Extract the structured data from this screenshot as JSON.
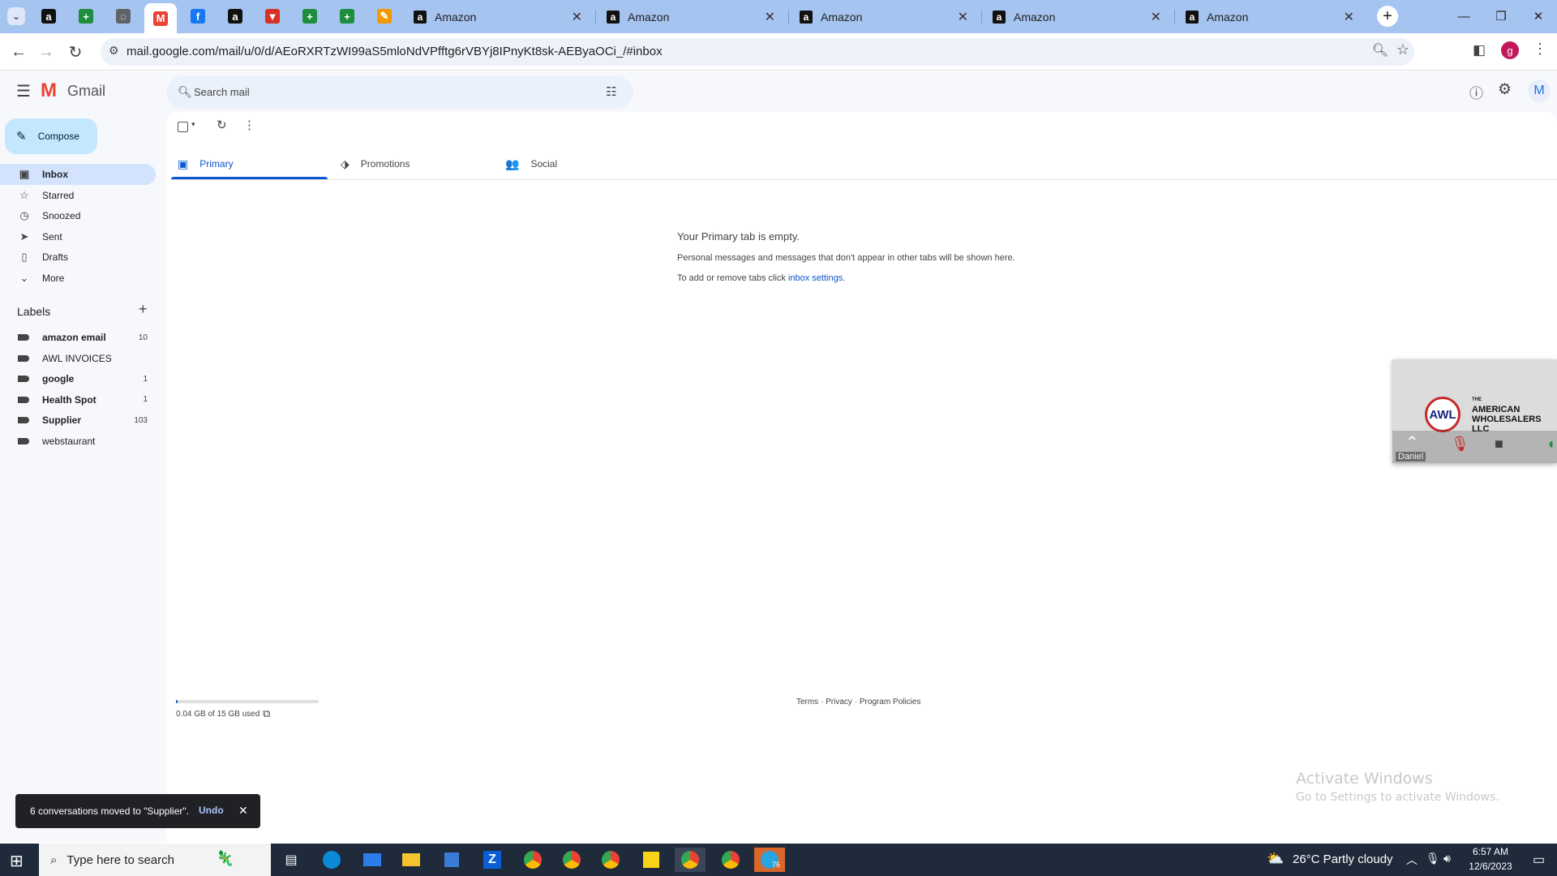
{
  "browser": {
    "pinned_tabs": [
      {
        "icon": "amazon-icon",
        "glyph": "a",
        "color": "#111111"
      },
      {
        "icon": "sheets-plus-icon",
        "glyph": "+",
        "color": "#1e8e3e"
      },
      {
        "icon": "globe-icon",
        "glyph": "◌",
        "color": "#5f6368"
      },
      {
        "icon": "gmail-icon",
        "glyph": "M",
        "color": "#ea4335"
      },
      {
        "icon": "facebook-icon",
        "glyph": "f",
        "color": "#1877f2"
      },
      {
        "icon": "amazon-icon",
        "glyph": "a",
        "color": "#111111"
      },
      {
        "icon": "red-shield-icon",
        "glyph": "▼",
        "color": "#d93025"
      },
      {
        "icon": "sheets-plus-icon",
        "glyph": "+",
        "color": "#1e8e3e"
      },
      {
        "icon": "sheets-plus-icon",
        "glyph": "+",
        "color": "#1e8e3e"
      },
      {
        "icon": "pencil-app-icon",
        "glyph": "✎",
        "color": "#f29900"
      }
    ],
    "tabs": [
      {
        "title": "Amazon"
      },
      {
        "title": "Amazon"
      },
      {
        "title": "Amazon"
      },
      {
        "title": "Amazon"
      },
      {
        "title": "Amazon"
      }
    ],
    "url": "mail.google.com/mail/u/0/d/AEoRXRTzWI99aS5mloNdVPfftg6rVBYj8IPnyKt8sk-AEByaOCi_/#inbox",
    "profile_initial": "g"
  },
  "gmail": {
    "logo_text": "Gmail",
    "search_placeholder": "Search mail",
    "compose_label": "Compose",
    "avatar_initial": "M",
    "nav": [
      {
        "label": "Inbox",
        "icon": "inbox-icon",
        "glyph": "▣",
        "active": true
      },
      {
        "label": "Starred",
        "icon": "star-icon",
        "glyph": "☆"
      },
      {
        "label": "Snoozed",
        "icon": "clock-icon",
        "glyph": "◷"
      },
      {
        "label": "Sent",
        "icon": "send-icon",
        "glyph": "➤"
      },
      {
        "label": "Drafts",
        "icon": "draft-icon",
        "glyph": "▯"
      },
      {
        "label": "More",
        "icon": "chevron-down-icon",
        "glyph": "⌄"
      }
    ],
    "labels_title": "Labels",
    "labels": [
      {
        "name": "amazon email",
        "count": "10",
        "bold": true
      },
      {
        "name": "AWL INVOICES",
        "count": "",
        "bold": false
      },
      {
        "name": "google",
        "count": "1",
        "bold": true
      },
      {
        "name": "Health Spot",
        "count": "1",
        "bold": true
      },
      {
        "name": "Supplier",
        "count": "103",
        "bold": true
      },
      {
        "name": "webstaurant",
        "count": "",
        "bold": false
      }
    ],
    "tabs": [
      {
        "label": "Primary",
        "icon": "inbox-icon",
        "glyph": "▣",
        "active": true
      },
      {
        "label": "Promotions",
        "icon": "tag-icon",
        "glyph": "⬗"
      },
      {
        "label": "Social",
        "icon": "people-icon",
        "glyph": "👥"
      }
    ],
    "empty": {
      "title": "Your Primary tab is empty.",
      "line1": "Personal messages and messages that don't appear in other tabs will be shown here.",
      "line2_prefix": "To add or remove tabs click ",
      "line2_link": "inbox settings",
      "line2_suffix": "."
    },
    "storage": "0.04 GB of 15 GB used",
    "storage_fraction": 0.003,
    "footer": {
      "terms": "Terms",
      "sep1": " · ",
      "privacy": "Privacy",
      "sep2": " · ",
      "policies": "Program Policies"
    },
    "snackbar": {
      "message": "6 conversations moved to \"Supplier\".",
      "undo": "Undo"
    }
  },
  "video_overlay": {
    "logo_line1": "AMERICAN",
    "logo_line2": "WHOLESALERS",
    "logo_line3": "LLC",
    "logo_abbr": "AWL",
    "logo_prefix": "THE",
    "participant": "Daniel"
  },
  "watermark": {
    "title": "Activate Windows",
    "subtitle": "Go to Settings to activate Windows."
  },
  "taskbar": {
    "search_placeholder": "Type here to search",
    "weather": "26°C  Partly cloudy",
    "time": "6:57 AM",
    "date": "12/6/2023",
    "telegram_badge": "76"
  },
  "colors": {
    "accent": "#0b57d0",
    "compose_bg": "#c2e7ff",
    "inbox_active": "#d3e3fd"
  }
}
